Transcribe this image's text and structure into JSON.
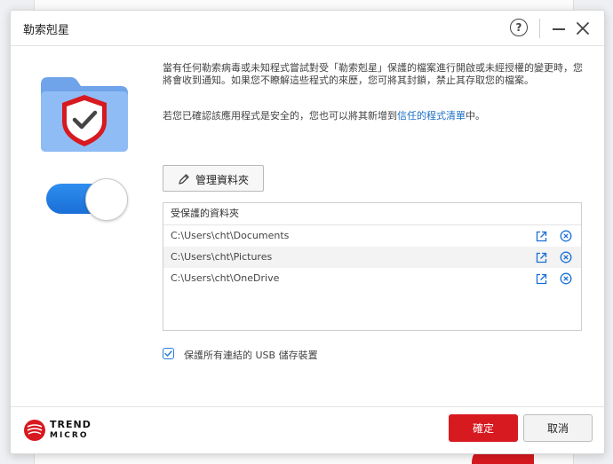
{
  "dialog": {
    "title": "勒索剋星"
  },
  "description": {
    "paragraph1": "當有任何勒索病毒或未知程式嘗試對受「勒索剋星」保護的檔案進行開啟或未經授權的變更時，您將會收到通知。如果您不瞭解這些程式的來歷，您可將其封鎖，禁止其存取您的檔案。",
    "paragraph2_prefix": "若您已確認該應用程式是安全的，您也可以將其新增到",
    "paragraph2_link": "信任的程式清單",
    "paragraph2_suffix": "中。"
  },
  "toggle": {
    "state": "on"
  },
  "manage_button": {
    "label": "管理資料夾"
  },
  "folders": {
    "header": "受保護的資料夾",
    "items": [
      {
        "path": "C:\\Users\\cht\\Documents"
      },
      {
        "path": "C:\\Users\\cht\\Pictures"
      },
      {
        "path": "C:\\Users\\cht\\OneDrive"
      }
    ]
  },
  "usb": {
    "label": "保護所有連結的 USB 儲存裝置",
    "checked": true
  },
  "footer": {
    "logo_line1": "TREND",
    "logo_line2": "MICRO",
    "ok_label": "確定",
    "cancel_label": "取消"
  },
  "colors": {
    "brand_red": "#d71920",
    "accent_blue": "#1a6fd6",
    "link_blue": "#1a6fc4"
  },
  "icons": {
    "help": "question-circle-icon",
    "minimize": "minimize-icon",
    "close": "close-icon",
    "folder": "folder-shield-icon",
    "pencil": "pencil-icon",
    "open": "open-external-icon",
    "remove": "remove-circle-icon",
    "logo": "trend-micro-logo-icon"
  }
}
